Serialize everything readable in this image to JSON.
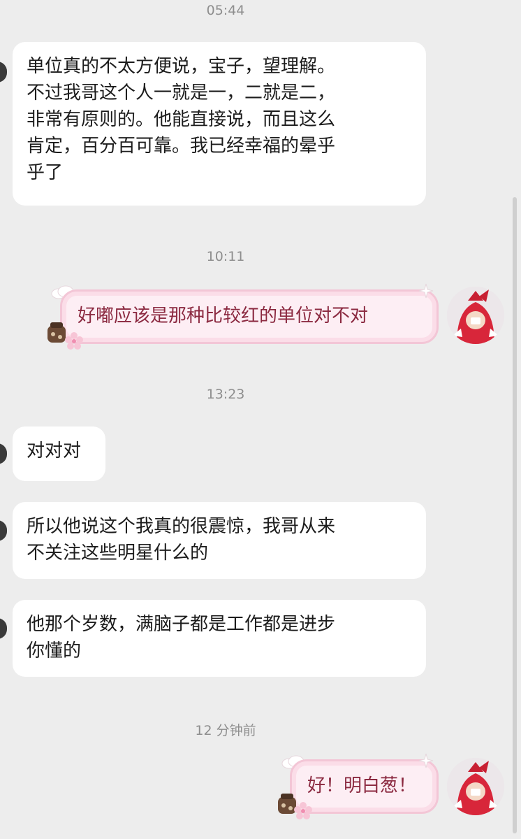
{
  "chat": {
    "timestamps": [
      "05:44",
      "10:11",
      "13:23",
      "12 分钟前"
    ],
    "messages": [
      {
        "side": "left",
        "text": "单位真的不太方便说，宝子，望理解。\n不过我哥这个人一就是一，二就是二，\n非常有原则的。他能直接说，而且这么\n肯定，百分百可靠。我已经幸福的晕乎\n乎了"
      },
      {
        "side": "right",
        "text": "好嘟应该是那种比较红的单位对不对"
      },
      {
        "side": "left",
        "text": "对对对"
      },
      {
        "side": "left",
        "text": "所以他说这个我真的很震惊，我哥从来\n不关注这些明星什么的"
      },
      {
        "side": "left",
        "text": "他那个岁数，满脑子都是工作都是进步\n你懂的"
      },
      {
        "side": "right",
        "text": "好！明白葱！"
      }
    ]
  },
  "colors": {
    "background": "#ededed",
    "incoming_bubble": "#ffffff",
    "outgoing_bubble": "#fdeef4",
    "outgoing_border": "#f3c6d6",
    "outgoing_text": "#8b2940",
    "timestamp_text": "#8e8e8e"
  },
  "icons": {
    "avatar": "red-cartoon-character-avatar",
    "bubble_decoration": "cherry-blossom-and-jar-sticker"
  }
}
